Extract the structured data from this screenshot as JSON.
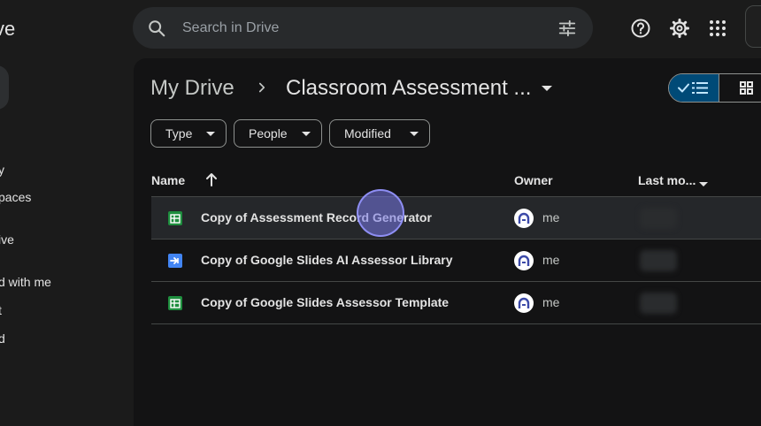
{
  "sidebar": {
    "app_title_fragment": "ve",
    "items": [
      {
        "label": "y"
      },
      {
        "label": "paces"
      },
      {
        "label": "ive"
      },
      {
        "label": "d with me"
      },
      {
        "label": "t"
      },
      {
        "label": "d"
      }
    ]
  },
  "search": {
    "placeholder": "Search in Drive",
    "icon": "search-icon",
    "filter_icon": "tune-icon"
  },
  "top_icons": [
    "help-icon",
    "settings-icon",
    "apps-icon"
  ],
  "breadcrumb": {
    "root": "My Drive",
    "separator_icon": "chevron-right-icon",
    "current": "Classroom Assessment ...",
    "caret_icon": "caret-down-icon"
  },
  "view_toggle": {
    "selected": "list",
    "list_icons": [
      "check-icon",
      "list-icon"
    ],
    "grid_icon": "grid-icon"
  },
  "filters": [
    {
      "label": "Type"
    },
    {
      "label": "People"
    },
    {
      "label": "Modified"
    }
  ],
  "table": {
    "columns": {
      "name": "Name",
      "owner": "Owner",
      "last_modified": "Last mo..."
    },
    "rows": [
      {
        "name": "Copy of Assessment Record Generator",
        "type": "sheets",
        "owner": "me"
      },
      {
        "name": "Copy of Google Slides AI Assessor Library",
        "type": "script",
        "owner": "me"
      },
      {
        "name": "Copy of Google Slides Assessor Template",
        "type": "sheets",
        "owner": "me"
      }
    ]
  },
  "colors": {
    "sheets": "#1e8e3e",
    "script": "#4285f4",
    "accent": "#004a77",
    "cursor": "#7878e6"
  }
}
